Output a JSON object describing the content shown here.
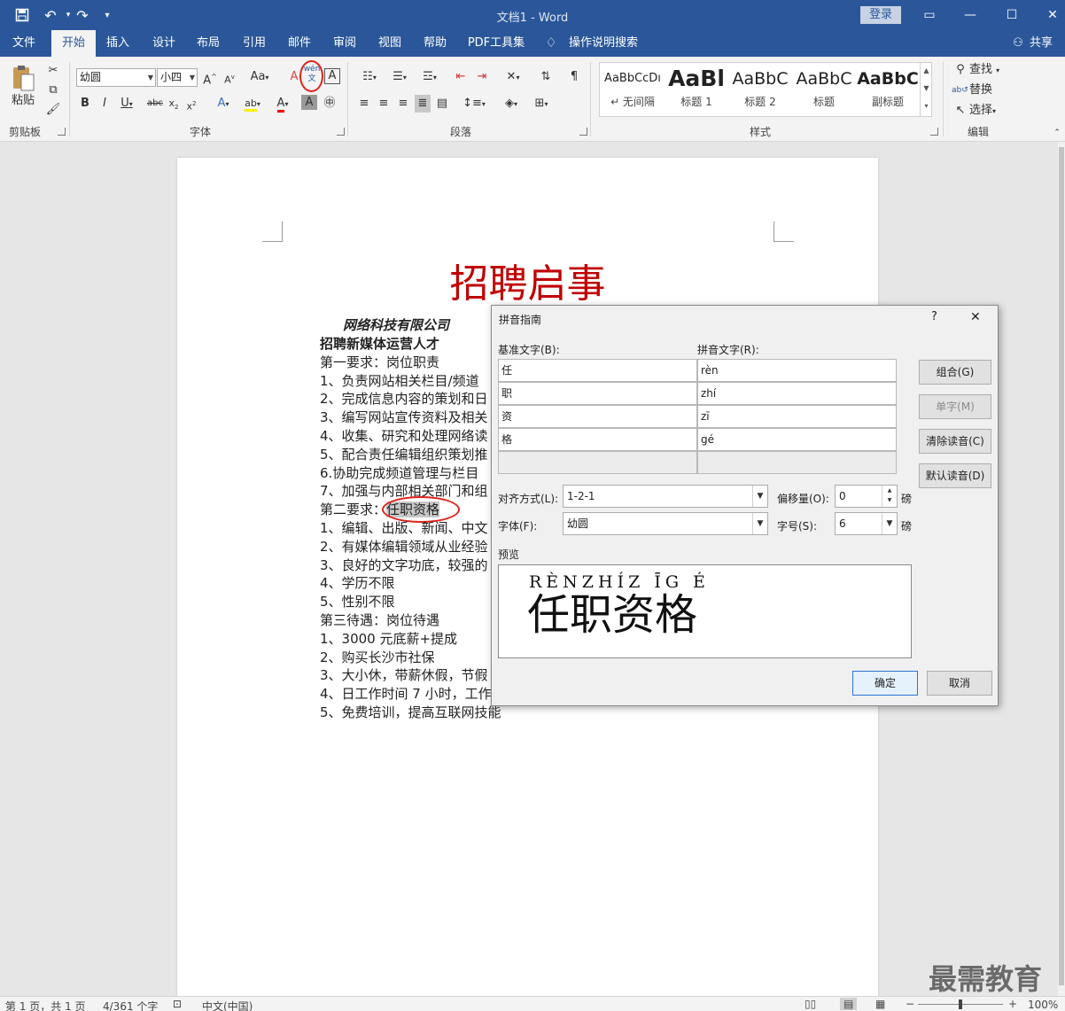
{
  "window": {
    "title": "文档1  -  Word",
    "login": "登录"
  },
  "tabs": [
    "文件",
    "开始",
    "插入",
    "设计",
    "布局",
    "引用",
    "邮件",
    "审阅",
    "视图",
    "帮助",
    "PDF工具集"
  ],
  "tell_me": "操作说明搜索",
  "share": "共享",
  "ribbon": {
    "clipboard": {
      "paste": "粘贴",
      "label": "剪贴板"
    },
    "font": {
      "name": "幼圆",
      "size": "小四",
      "label": "字体",
      "phonetic": "wén\n文",
      "aa": "Aa"
    },
    "paragraph": {
      "label": "段落"
    },
    "styles": {
      "label": "样式",
      "items": [
        {
          "preview": "AaBbCcDı",
          "name": "↵ 无间隔"
        },
        {
          "preview": "AaBl",
          "name": "标题 1"
        },
        {
          "preview": "AaBbC",
          "name": "标题 2"
        },
        {
          "preview": "AaBbC",
          "name": "标题"
        },
        {
          "preview": "AaBbC",
          "name": "副标题"
        }
      ]
    },
    "editing": {
      "find": "查找",
      "replace": "替换",
      "select": "选择",
      "label": "编辑"
    }
  },
  "document": {
    "heading": "招聘启事",
    "lines": [
      "网络科技有限公司",
      "招聘新媒体运营人才",
      "第一要求：岗位职责",
      "1、负责网站相关栏目/频道",
      "2、完成信息内容的策划和日",
      "3、编写网站宣传资料及相关",
      "4、收集、研究和处理网络读",
      "5、配合责任编辑组织策划推",
      "6.协助完成频道管理与栏目",
      "7、加强与内部相关部门和组",
      "第二要求：",
      "1、编辑、出版、新闻、中文",
      "2、有媒体编辑领域从业经验",
      "3、良好的文字功底，较强的",
      "4、学历不限",
      "5、性别不限",
      "第三待遇：岗位待遇",
      "1、3000 元底薪+提成",
      "2、购买长沙市社保",
      "3、大小休，带薪休假，节假",
      "4、日工作时间 7 小时，工作",
      "5、免费培训，提高互联网技能"
    ],
    "highlight": "任职资格"
  },
  "dialog": {
    "title": "拼音指南",
    "help": "?",
    "close": "✕",
    "base_label": "基准文字(B):",
    "ruby_label": "拼音文字(R):",
    "rows": [
      {
        "base": "任",
        "ruby": "rèn"
      },
      {
        "base": "职",
        "ruby": "zhí"
      },
      {
        "base": "资",
        "ruby": "zī"
      },
      {
        "base": "格",
        "ruby": "gé"
      },
      {
        "base": "",
        "ruby": ""
      }
    ],
    "buttons": {
      "group": "组合(G)",
      "mono": "单字(M)",
      "clear": "清除读音(C)",
      "default": "默认读音(D)",
      "ok": "确定",
      "cancel": "取消"
    },
    "align_label": "对齐方式(L):",
    "align_value": "1-2-1",
    "offset_label": "偏移量(O):",
    "offset_value": "0",
    "unit": "磅",
    "font_label": "字体(F):",
    "font_value": "幼圆",
    "size_label": "字号(S):",
    "size_value": "6",
    "preview_label": "预览",
    "preview_ruby": "RÈNZHÍZ ĪG É",
    "preview_base": "任职资格"
  },
  "status": {
    "page": "第 1 页，共 1 页",
    "words": "4/361 个字",
    "lang": "中文(中国)",
    "zoom": "100%"
  },
  "watermark": "最需教育",
  "colors": {
    "accent": "#2b579a",
    "heading": "#c00000",
    "annotation": "#e0221b"
  }
}
